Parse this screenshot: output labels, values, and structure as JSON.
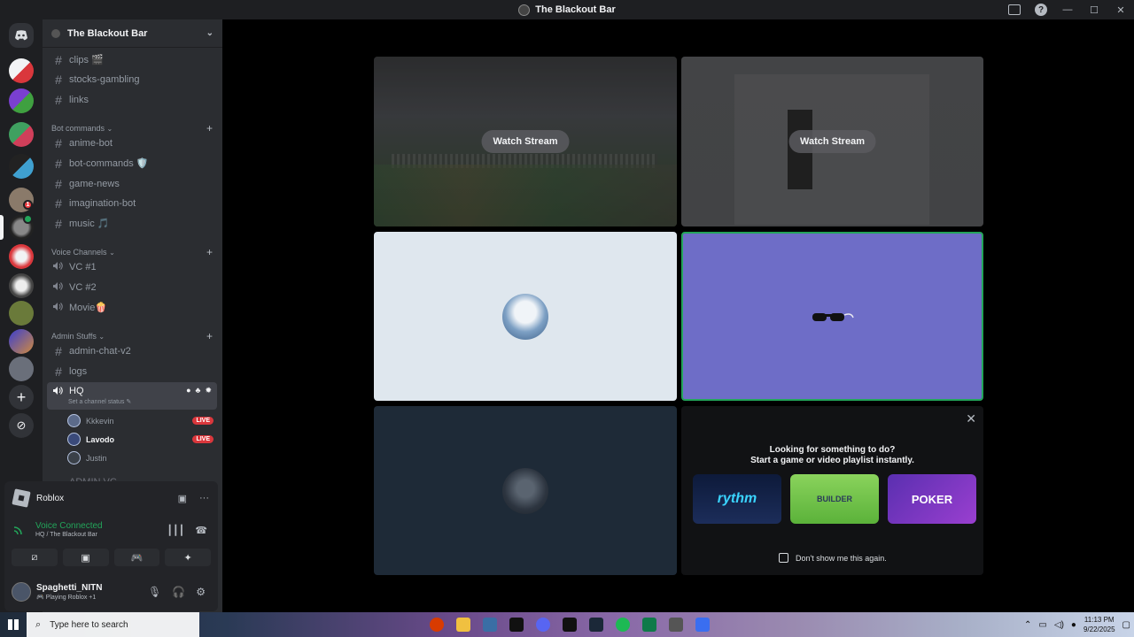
{
  "window": {
    "title": "The Blackout Bar"
  },
  "server": {
    "name": "The Blackout Bar"
  },
  "channels": {
    "top": [
      {
        "name": "clips 🎬"
      },
      {
        "name": "stocks-gambling"
      },
      {
        "name": "links"
      }
    ],
    "bot_category": "Bot commands",
    "bot": [
      {
        "name": "anime-bot"
      },
      {
        "name": "bot-commands 🛡️"
      },
      {
        "name": "game-news"
      },
      {
        "name": "imagination-bot"
      },
      {
        "name": "music 🎵"
      }
    ],
    "voice_category": "Voice Channels",
    "voice": [
      {
        "name": "VC #1"
      },
      {
        "name": "VC #2"
      },
      {
        "name": "Movie🍿"
      }
    ],
    "admin_category": "Admin Stuffs",
    "admin": [
      {
        "name": "admin-chat-v2"
      },
      {
        "name": "logs"
      }
    ],
    "hq": {
      "name": "HQ",
      "status_placeholder": "Set a channel status"
    },
    "hq_users": [
      {
        "name": "Kkkevin",
        "live": "LIVE"
      },
      {
        "name": "Lavodo",
        "live": "LIVE"
      },
      {
        "name": "Justin",
        "live": ""
      }
    ],
    "cut_off": "ADMIN VC"
  },
  "guild_badges": {
    "one": "1",
    "two": "1"
  },
  "panel": {
    "activity": "Roblox",
    "voice_status": "Voice Connected",
    "voice_location": "HQ / The Blackout Bar",
    "user_name": "Spaghetti_NITN",
    "user_activity": "🎮 Playing Roblox +1"
  },
  "stage": {
    "watch_label_1": "Watch Stream",
    "watch_label_2": "Watch Stream",
    "activity_line1": "Looking for something to do?",
    "activity_line2": "Start a game or video playlist instantly.",
    "card_rythm": "rythm",
    "card_builder": "BUILDER",
    "card_poker": "POKER",
    "dont_show": "Don't show me this again."
  },
  "taskbar": {
    "search_placeholder": "Type here to search",
    "time": "11:13 PM",
    "date": "9/22/2025"
  }
}
